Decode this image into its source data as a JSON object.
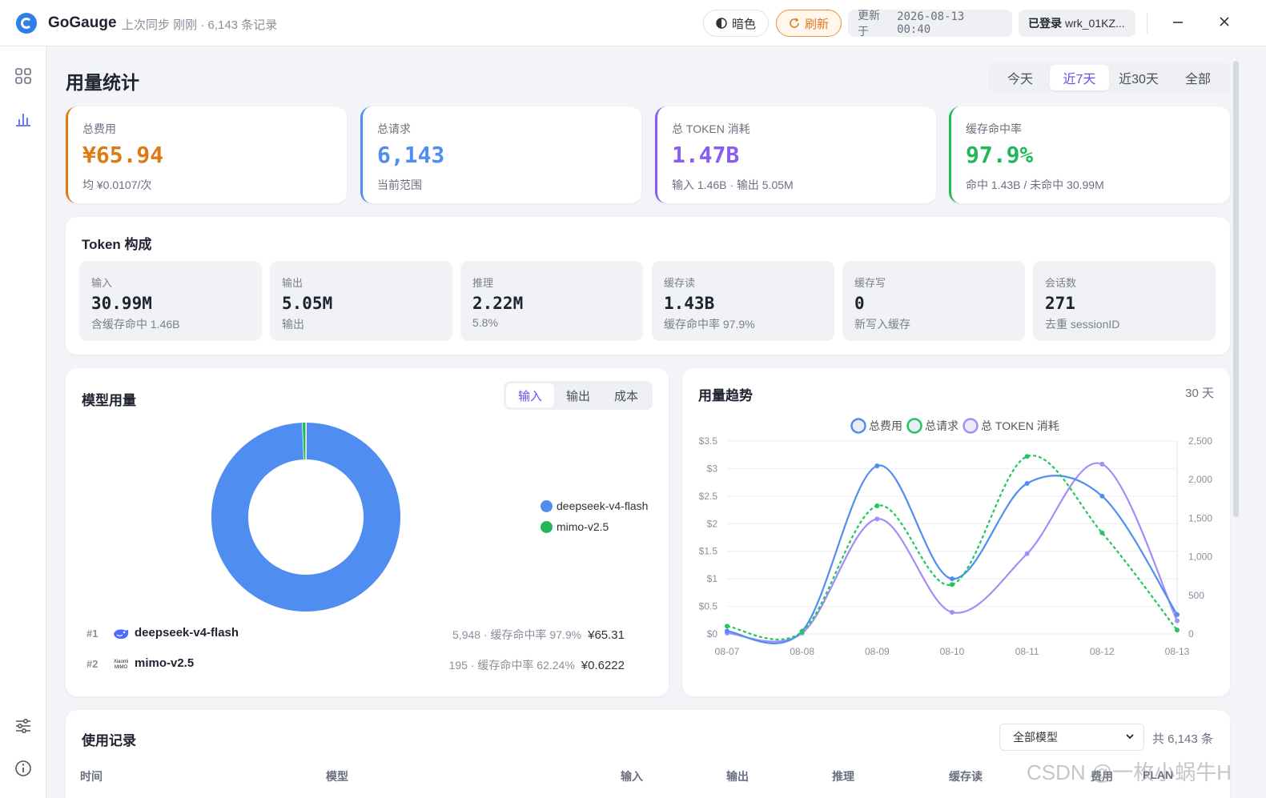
{
  "titlebar": {
    "app_name": "GoGauge",
    "sync_info": "上次同步 刚刚 · 6,143 条记录",
    "dark_label": "暗色",
    "refresh_label": "刷新",
    "updated_prefix": "更新于",
    "updated_time": "2026-08-13 00:40",
    "login_label": "已登录",
    "user_id": "wrk_01KZ..."
  },
  "page": {
    "title": "用量统计",
    "ranges": [
      "今天",
      "近7天",
      "近30天",
      "全部"
    ],
    "active_range": "近7天"
  },
  "stats": [
    {
      "label": "总费用",
      "value": "¥65.94",
      "sub": "均 ¥0.0107/次",
      "color": "#dd7a16"
    },
    {
      "label": "总请求",
      "value": "6,143",
      "sub": "当前范围",
      "color": "#4f8ef0"
    },
    {
      "label": "总 TOKEN 消耗",
      "value": "1.47B",
      "sub": "输入 1.46B · 输出 5.05M",
      "color": "#8a5cf0"
    },
    {
      "label": "缓存命中率",
      "value": "97.9%",
      "sub": "命中 1.43B / 未命中 30.99M",
      "color": "#22b85a"
    }
  ],
  "token": {
    "title": "Token 构成",
    "items": [
      {
        "label": "输入",
        "value": "30.99M",
        "sub": "含缓存命中 1.46B"
      },
      {
        "label": "输出",
        "value": "5.05M",
        "sub": "输出"
      },
      {
        "label": "推理",
        "value": "2.22M",
        "sub": "5.8%"
      },
      {
        "label": "缓存读",
        "value": "1.43B",
        "sub": "缓存命中率 97.9%"
      },
      {
        "label": "缓存写",
        "value": "0",
        "sub": "新写入缓存"
      },
      {
        "label": "会话数",
        "value": "271",
        "sub": "去重 sessionID"
      }
    ]
  },
  "models": {
    "title": "模型用量",
    "tabs": [
      "输入",
      "输出",
      "成本"
    ],
    "active_tab": "输入",
    "legend": [
      {
        "name": "deepseek-v4-flash",
        "color": "#4f8ef0"
      },
      {
        "name": "mimo-v2.5",
        "color": "#22b85a"
      }
    ],
    "ranking": [
      {
        "rank": "#1",
        "name": "deepseek-v4-flash",
        "meta": "5,948 · 缓存命中率 97.9%",
        "cost": "¥65.31"
      },
      {
        "rank": "#2",
        "name": "mimo-v2.5",
        "meta": "195 · 缓存命中率 62.24%",
        "cost": "¥0.6222"
      }
    ],
    "mimo_logo_text": [
      "Xiaomi",
      "MIMO"
    ]
  },
  "trend": {
    "title": "用量趋势",
    "days": "30 天"
  },
  "chart_data": [
    {
      "type": "pie",
      "donut": true,
      "categories": [
        "deepseek-v4-flash",
        "mimo-v2.5"
      ],
      "values": [
        99.3,
        0.7
      ],
      "colors": [
        "#4f8ef0",
        "#22b85a"
      ]
    },
    {
      "type": "line",
      "x": [
        "08-07",
        "08-08",
        "08-09",
        "08-10",
        "08-11",
        "08-12",
        "08-13"
      ],
      "y_left": {
        "ticks": [
          "$0",
          "$0.5",
          "$1",
          "$1.5",
          "$2",
          "$2.5",
          "$3",
          "$3.5"
        ],
        "min": 0,
        "max": 3.5
      },
      "y_right": {
        "ticks": [
          "0",
          "500",
          "1,000",
          "1,500",
          "2,000",
          "2,500"
        ],
        "min": 0,
        "max": 2500
      },
      "legend": "top",
      "series": [
        {
          "name": "总费用",
          "axis": "left",
          "color": "#4f8ef0",
          "dashed": false,
          "values": [
            0.05,
            0.05,
            3.05,
            1.0,
            2.73,
            2.5,
            0.35
          ]
        },
        {
          "name": "总请求",
          "axis": "right",
          "color": "#22c55e",
          "dashed": true,
          "values": [
            100,
            30,
            1660,
            640,
            2300,
            1310,
            50
          ]
        },
        {
          "name": "总 TOKEN 消耗",
          "axis": "right",
          "color": "#a78bfa",
          "dashed": false,
          "values": [
            10,
            10,
            1490,
            280,
            1040,
            2200,
            170
          ]
        }
      ]
    }
  ],
  "records": {
    "title": "使用记录",
    "filter": "全部模型",
    "total": "共 6,143 条",
    "columns": [
      "时间",
      "模型",
      "输入",
      "输出",
      "推理",
      "缓存读",
      "费用",
      "PLAN"
    ]
  },
  "watermark": "CSDN @一枚小蜗牛H"
}
